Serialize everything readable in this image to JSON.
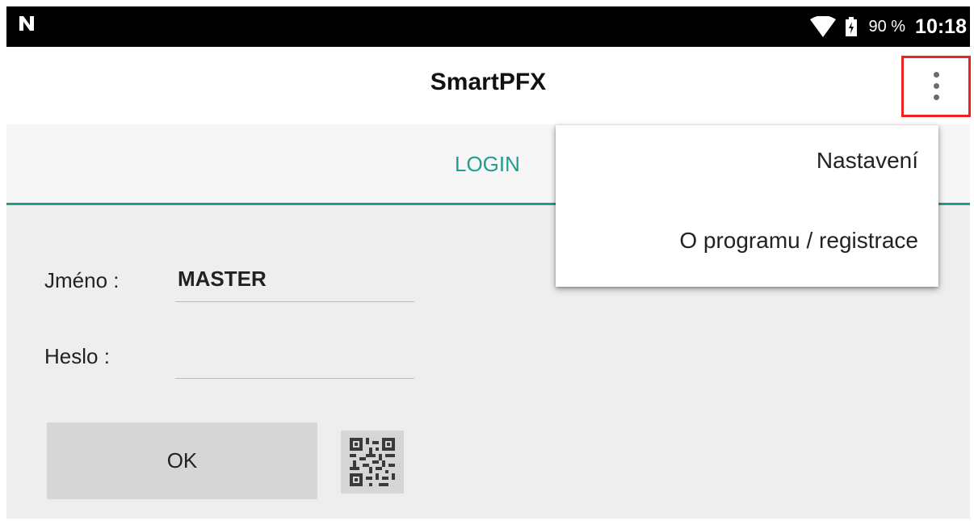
{
  "status_bar": {
    "battery": "90 %",
    "time": "10:18",
    "icons": [
      "notification-n-icon",
      "wifi-icon",
      "battery-charging-icon"
    ]
  },
  "app_bar": {
    "title": "SmartPFX",
    "overflow_icon": "more-vert-icon"
  },
  "tabs": [
    {
      "label": "LOGIN",
      "active": true
    }
  ],
  "form": {
    "username_label": "Jméno :",
    "username_value": "MASTER",
    "password_label": "Heslo :",
    "password_value": "",
    "ok_label": "OK",
    "qr_icon": "qr-code-icon"
  },
  "menu": {
    "items": [
      {
        "label": "Nastavení"
      },
      {
        "label": "O programu / registrace"
      }
    ]
  },
  "colors": {
    "accent": "#1f9e8f",
    "highlight": "#e8251f",
    "status_bar": "#000000",
    "content_bg": "#eeeeee",
    "button_bg": "#d6d6d6"
  }
}
